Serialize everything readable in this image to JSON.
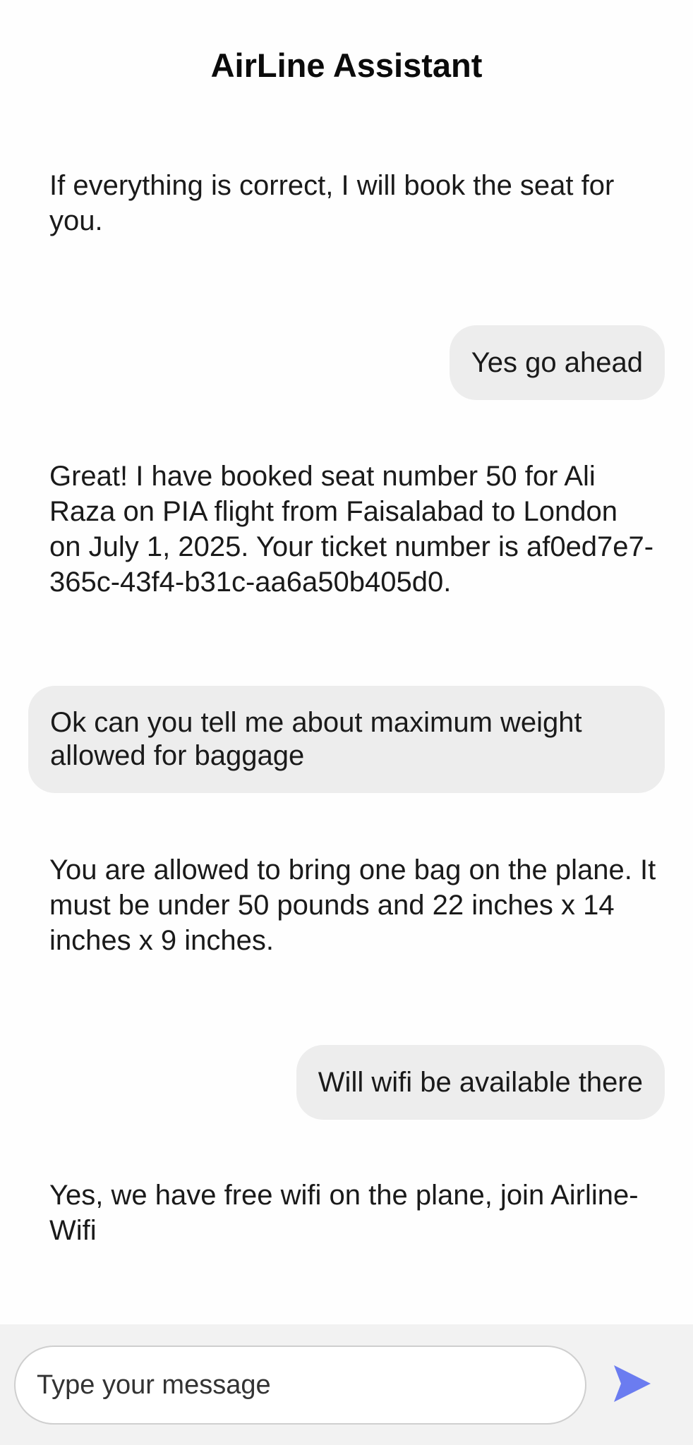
{
  "header": {
    "title": "AirLine Assistant"
  },
  "messages": [
    {
      "role": "assistant",
      "text": "If everything is correct, I will book the seat for you."
    },
    {
      "role": "user",
      "text": "Yes go ahead"
    },
    {
      "role": "assistant",
      "text": "Great! I have booked seat number 50 for Ali Raza on PIA flight from Faisalabad to London on July 1, 2025. Your ticket number is af0ed7e7-365c-43f4-b31c-aa6a50b405d0."
    },
    {
      "role": "user",
      "text": "Ok can you tell me about maximum weight allowed for baggage"
    },
    {
      "role": "assistant",
      "text": "You are allowed to bring one bag on the plane. It must be under 50 pounds and 22 inches x 14 inches x 9 inches."
    },
    {
      "role": "user",
      "text": "Will wifi be available there"
    },
    {
      "role": "assistant",
      "text": "Yes, we have free wifi on the plane, join Airline-Wifi"
    }
  ],
  "composer": {
    "value": "",
    "placeholder": "Type your message",
    "send_icon": "send-icon"
  },
  "colors": {
    "user_bubble": "#ededed",
    "send_icon": "#6b7cf0",
    "footer_bg": "#f2f2f2"
  }
}
